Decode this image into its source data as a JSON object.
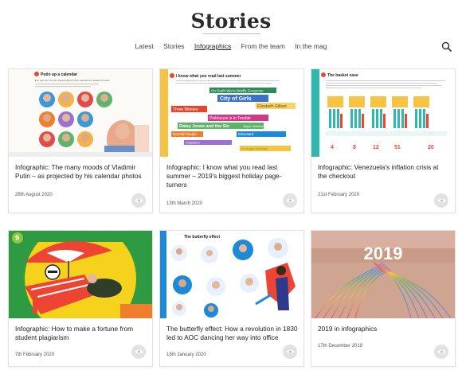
{
  "header": {
    "title": "Stories"
  },
  "nav": {
    "items": [
      "Latest",
      "Stories",
      "Infographics",
      "From the team",
      "In the mag"
    ],
    "active": "Infographics"
  },
  "cards": [
    {
      "title": "Infographic: The many moods of Vladimir Putin – as projected by his calendar photos",
      "date": "28th August 2020",
      "thumb_heading": "Putin up a calendar",
      "thumb_caption": "Ever year a lot of trends wrapped Vladimir Putin calendars are released in Russia"
    },
    {
      "title": "Infographic: I know what you read last summer – 2019's biggest holiday page-turners",
      "date": "13th March 2020",
      "thumb_heading": "I know what you read last summer",
      "thumb_books": [
        "On Earth We're Briefly Gorgeous",
        "City of Girls",
        "Elizabeth Gilbert",
        "Three Women",
        "Pinkhouse is in Trouble",
        "Daisy Jones and the Six",
        "Taylor Jenkins Reid",
        "Normal People",
        "Educated",
        "Underland",
        "An Anglo Marriage"
      ]
    },
    {
      "title": "Infographic: Venezuela's inflation crisis at the checkout",
      "date": "21st February 2020",
      "thumb_heading": "The basket case",
      "thumb_numbers": [
        "4",
        "8",
        "12",
        "51",
        "20"
      ]
    },
    {
      "title": "Infographic: How to make a fortune from student plagiarism",
      "date": "7th February 2020",
      "thumb_badge": "9"
    },
    {
      "title": "The butterfly effect: How a revolution in 1830 led to AOC dancing her way into office",
      "date": "16th January 2020",
      "thumb_heading": "The butterfly effect"
    },
    {
      "title": "2019 in infographics",
      "date": "17th December 2019",
      "thumb_year": "2019"
    }
  ],
  "colors": {
    "accent": "#2b2b2b",
    "eye_bg": "#e2e2e2",
    "yellow": "#f6c343",
    "teal": "#2fb8b0",
    "orange": "#f07f2d",
    "blue": "#1d8ad9"
  },
  "icons": [
    "search-icon",
    "eye-icon"
  ]
}
